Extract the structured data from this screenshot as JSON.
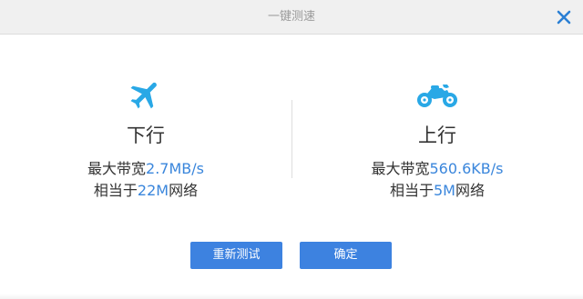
{
  "window": {
    "title": "一键测速"
  },
  "download": {
    "icon": "airplane-icon",
    "label": "下行",
    "bandwidth_prefix": "最大带宽",
    "bandwidth_value": "2.7MB/s",
    "network_prefix": "相当于",
    "network_value": "22M",
    "network_suffix": "网络"
  },
  "upload": {
    "icon": "motorcycle-icon",
    "label": "上行",
    "bandwidth_prefix": "最大带宽",
    "bandwidth_value": "560.6KB/s",
    "network_prefix": "相当于",
    "network_value": "5M",
    "network_suffix": "网络"
  },
  "buttons": {
    "retest_label": "重新测试",
    "confirm_label": "确定"
  },
  "colors": {
    "accent": "#3a86dc",
    "button": "#3d82e0",
    "icon": "#29a8e6",
    "close": "#2a7fd4"
  }
}
